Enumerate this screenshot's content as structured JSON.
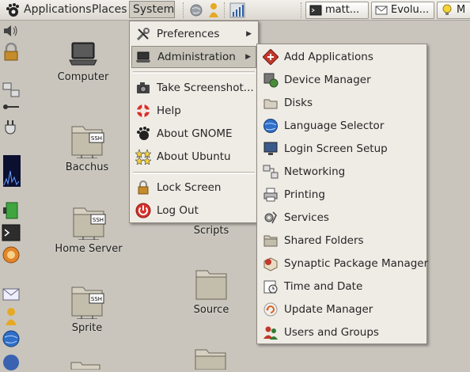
{
  "panel": {
    "menus": [
      "Applications",
      "Places",
      "System"
    ],
    "tasks": [
      "matt...",
      "Evolu...",
      "M"
    ]
  },
  "desktop": {
    "items": [
      "Computer",
      "Bacchus",
      "Home Server",
      "Scripts",
      "Sprite",
      "Source"
    ]
  },
  "system_menu": {
    "items": [
      "Preferences",
      "Administration",
      "Take Screenshot...",
      "Help",
      "About GNOME",
      "About Ubuntu",
      "Lock Screen",
      "Log Out"
    ]
  },
  "admin_menu": {
    "items": [
      "Add Applications",
      "Device Manager",
      "Disks",
      "Language Selector",
      "Login Screen Setup",
      "Networking",
      "Printing",
      "Services",
      "Shared Folders",
      "Synaptic Package Manager",
      "Time and Date",
      "Update Manager",
      "Users and Groups"
    ]
  },
  "colors": {
    "panel": "#e8e5df",
    "menu_bg": "#efebe5",
    "highlight": "#c8c4ba",
    "desktop": "#c9c5bd"
  },
  "icons": {
    "panel": [
      "gnome-foot-icon",
      "globe-icon",
      "person-icon",
      "system-monitor-icon"
    ],
    "dock": [
      "volume-icon",
      "lock-icon",
      "network-icon",
      "usb-icon",
      "power-plug-icon",
      "cpu-graph-icon",
      "battery-icon",
      "terminal-icon",
      "firefox-icon",
      "mail-icon",
      "person-icon",
      "globe-icon"
    ]
  }
}
